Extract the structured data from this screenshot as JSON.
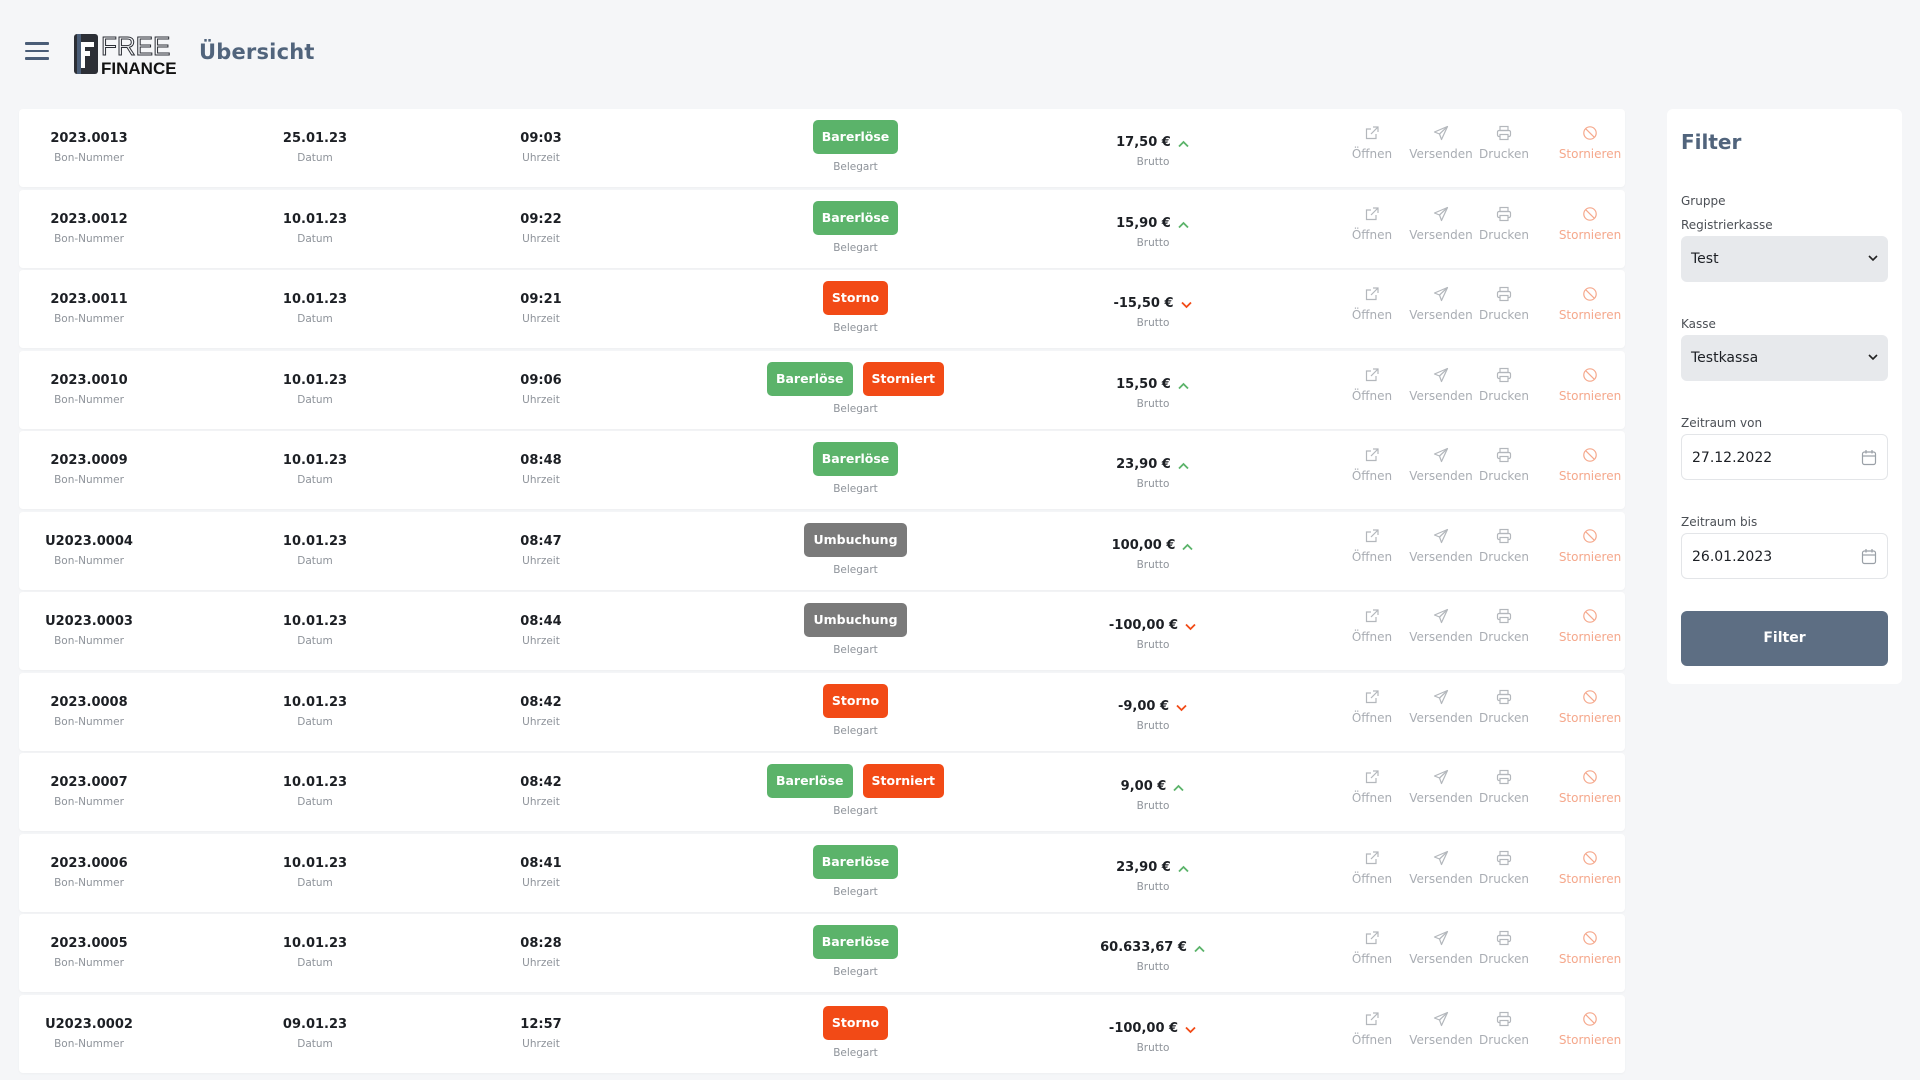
{
  "header": {
    "title": "Übersicht",
    "logo_top": "FREE",
    "logo_bottom": "FINANCE"
  },
  "labels": {
    "bon": "Bon-Nummer",
    "date": "Datum",
    "time": "Uhrzeit",
    "type": "Belegart",
    "amount": "Brutto",
    "open": "Öffnen",
    "send": "Versenden",
    "print": "Drucken",
    "cancel": "Stornieren"
  },
  "colors": {
    "up": "#5bb36a",
    "down": "#f24a16",
    "green": "#5bb36a",
    "red": "#f24a16",
    "grey": "#7a7a7a"
  },
  "rows": [
    {
      "bon": "2023.0013",
      "date": "25.01.23",
      "time": "09:03",
      "badges": [
        {
          "text": "Barerlöse",
          "color": "green"
        }
      ],
      "amount": "17,50 €",
      "trend": "up"
    },
    {
      "bon": "2023.0012",
      "date": "10.01.23",
      "time": "09:22",
      "badges": [
        {
          "text": "Barerlöse",
          "color": "green"
        }
      ],
      "amount": "15,90 €",
      "trend": "up"
    },
    {
      "bon": "2023.0011",
      "date": "10.01.23",
      "time": "09:21",
      "badges": [
        {
          "text": "Storno",
          "color": "red"
        }
      ],
      "amount": "-15,50 €",
      "trend": "down"
    },
    {
      "bon": "2023.0010",
      "date": "10.01.23",
      "time": "09:06",
      "badges": [
        {
          "text": "Barerlöse",
          "color": "green"
        },
        {
          "text": "Storniert",
          "color": "red"
        }
      ],
      "amount": "15,50 €",
      "trend": "up"
    },
    {
      "bon": "2023.0009",
      "date": "10.01.23",
      "time": "08:48",
      "badges": [
        {
          "text": "Barerlöse",
          "color": "green"
        }
      ],
      "amount": "23,90 €",
      "trend": "up"
    },
    {
      "bon": "U2023.0004",
      "date": "10.01.23",
      "time": "08:47",
      "badges": [
        {
          "text": "Umbuchung",
          "color": "grey"
        }
      ],
      "amount": "100,00 €",
      "trend": "up"
    },
    {
      "bon": "U2023.0003",
      "date": "10.01.23",
      "time": "08:44",
      "badges": [
        {
          "text": "Umbuchung",
          "color": "grey"
        }
      ],
      "amount": "-100,00 €",
      "trend": "down"
    },
    {
      "bon": "2023.0008",
      "date": "10.01.23",
      "time": "08:42",
      "badges": [
        {
          "text": "Storno",
          "color": "red"
        }
      ],
      "amount": "-9,00 €",
      "trend": "down"
    },
    {
      "bon": "2023.0007",
      "date": "10.01.23",
      "time": "08:42",
      "badges": [
        {
          "text": "Barerlöse",
          "color": "green"
        },
        {
          "text": "Storniert",
          "color": "red"
        }
      ],
      "amount": "9,00 €",
      "trend": "up"
    },
    {
      "bon": "2023.0006",
      "date": "10.01.23",
      "time": "08:41",
      "badges": [
        {
          "text": "Barerlöse",
          "color": "green"
        }
      ],
      "amount": "23,90 €",
      "trend": "up"
    },
    {
      "bon": "2023.0005",
      "date": "10.01.23",
      "time": "08:28",
      "badges": [
        {
          "text": "Barerlöse",
          "color": "green"
        }
      ],
      "amount": "60.633,67 €",
      "trend": "up"
    },
    {
      "bon": "U2023.0002",
      "date": "09.01.23",
      "time": "12:57",
      "badges": [
        {
          "text": "Storno",
          "color": "red"
        }
      ],
      "amount": "-100,00 €",
      "trend": "down"
    }
  ],
  "filter": {
    "title": "Filter",
    "group_label": "Gruppe",
    "register_label": "Registrierkasse",
    "register_value": "Test",
    "kasse_label": "Kasse",
    "kasse_value": "Testkassa",
    "from_label": "Zeitraum von",
    "from_value": "27.12.2022",
    "to_label": "Zeitraum bis",
    "to_value": "26.01.2023",
    "button": "Filter"
  }
}
